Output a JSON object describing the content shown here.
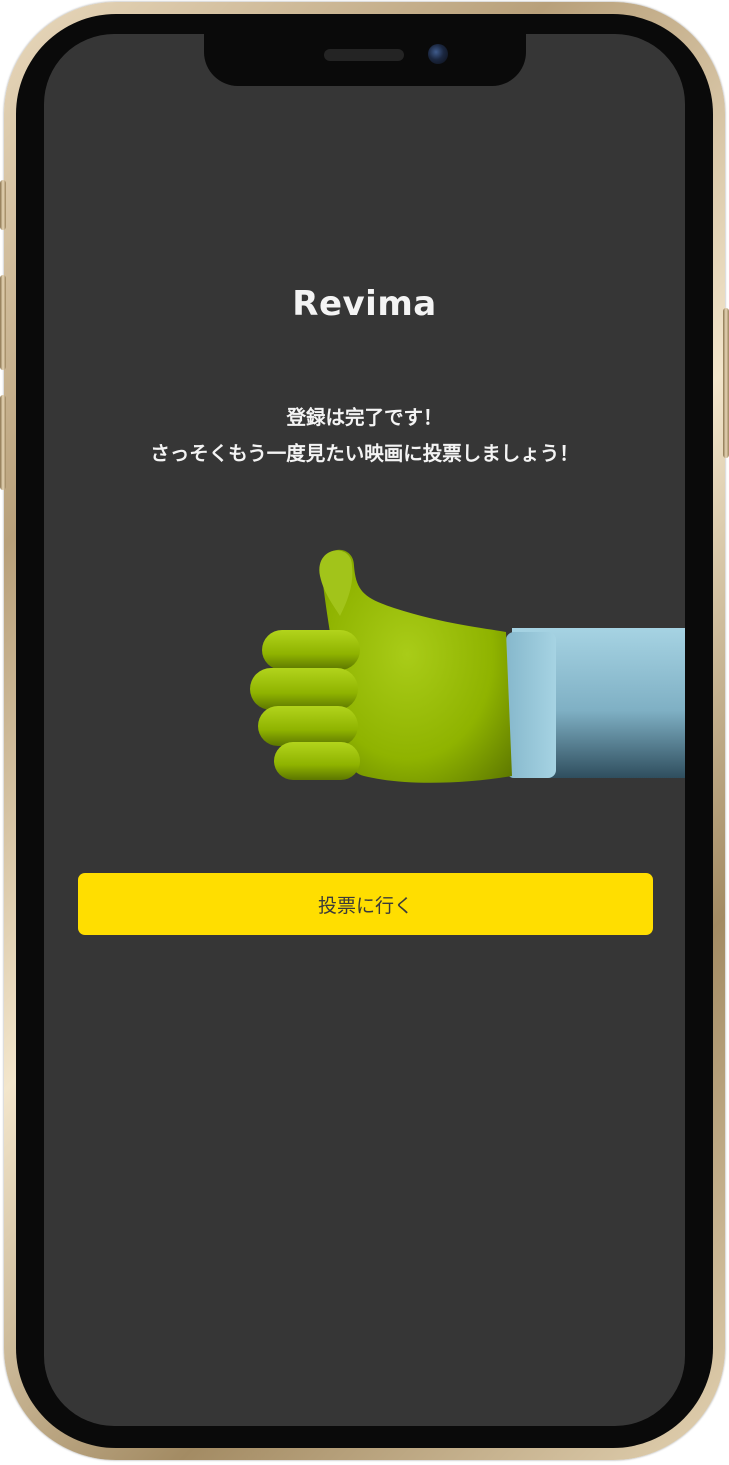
{
  "app": {
    "title": "Revima"
  },
  "message": {
    "line1": "登録は完了です！",
    "line2": "さっそくもう一度見たい映画に投票しましょう！"
  },
  "illustration": {
    "icon": "thumbs-up-hand-icon",
    "hand_color": "#8fb300",
    "sleeve_color": "#86b8cc"
  },
  "cta": {
    "label": "投票に行く",
    "color": "#ffde00"
  },
  "colors": {
    "screen_background": "#363636",
    "text": "#f4f4f4"
  }
}
